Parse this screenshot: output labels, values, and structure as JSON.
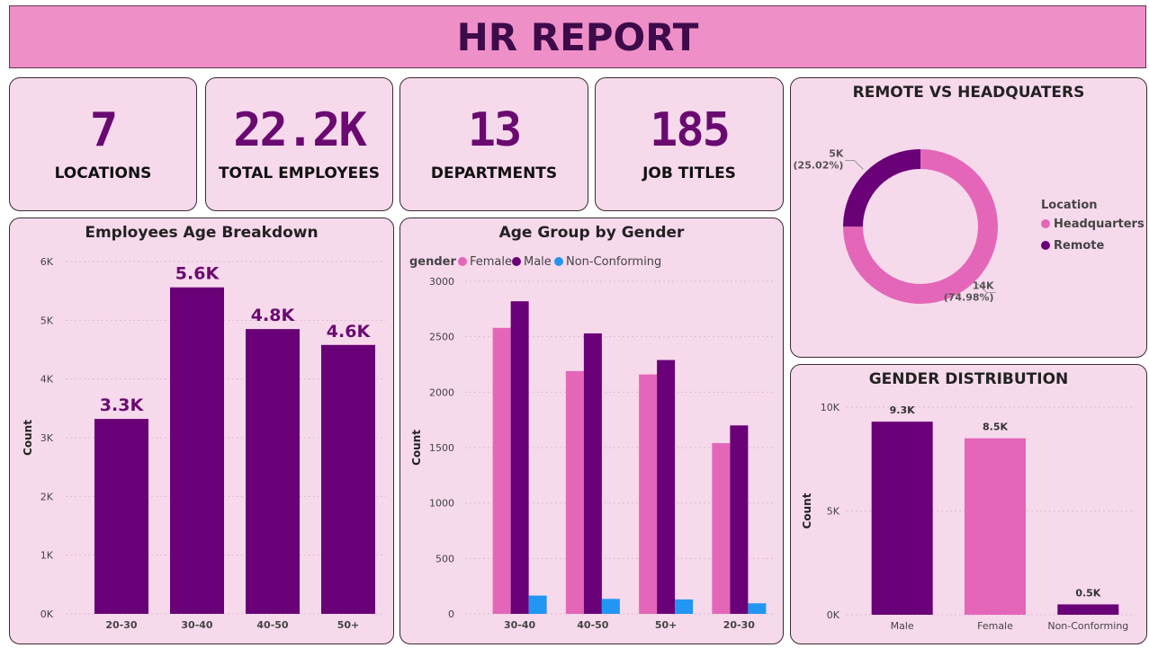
{
  "header": {
    "title": "HR REPORT"
  },
  "kpis": [
    {
      "value": "7",
      "label": "LOCATIONS"
    },
    {
      "value": "22.2K",
      "label": "TOTAL EMPLOYEES"
    },
    {
      "value": "13",
      "label": "DEPARTMENTS"
    },
    {
      "value": "185",
      "label": "JOB TITLES"
    }
  ],
  "colors": {
    "dark_purple": "#6a0077",
    "pink": "#e466b8",
    "blue": "#2196f3",
    "card_bg": "#f7d9ec",
    "header_bg": "#ee8fc8"
  },
  "chart_data": [
    {
      "type": "bar",
      "title": "Employees Age Breakdown",
      "xlabel": "",
      "ylabel": "Count",
      "categories": [
        "20-30",
        "30-40",
        "40-50",
        "50+"
      ],
      "values": [
        3320,
        5560,
        4850,
        4580
      ],
      "data_labels": [
        "3.3K",
        "5.6K",
        "4.8K",
        "4.6K"
      ],
      "ylim": [
        0,
        6000
      ],
      "yticks": [
        0,
        1000,
        2000,
        3000,
        4000,
        5000,
        6000
      ],
      "ytick_labels": [
        "0K",
        "1K",
        "2K",
        "3K",
        "4K",
        "5K",
        "6K"
      ],
      "grid": true
    },
    {
      "type": "bar",
      "title": "Age Group by Gender",
      "xlabel": "",
      "ylabel": "Count",
      "legend_title": "gender",
      "legend_position": "top-left",
      "categories": [
        "30-40",
        "40-50",
        "50+",
        "20-30"
      ],
      "series": [
        {
          "name": "Female",
          "color": "#e466b8",
          "values": [
            2580,
            2190,
            2160,
            1540
          ]
        },
        {
          "name": "Male",
          "color": "#6a0077",
          "values": [
            2820,
            2530,
            2290,
            1700
          ]
        },
        {
          "name": "Non-Conforming",
          "color": "#2196f3",
          "values": [
            165,
            135,
            130,
            95
          ]
        }
      ],
      "ylim": [
        0,
        3000
      ],
      "yticks": [
        0,
        500,
        1000,
        1500,
        2000,
        2500,
        3000
      ],
      "ytick_labels": [
        "0",
        "500",
        "1000",
        "1500",
        "2000",
        "2500",
        "3000"
      ],
      "grid": true
    },
    {
      "type": "pie",
      "subtype": "donut",
      "title": "REMOTE VS HEADQUATERS",
      "legend_title": "Location",
      "legend_position": "right",
      "slices": [
        {
          "name": "Headquarters",
          "value": 74.98,
          "label": "14K",
          "percent_label": "(74.98%)",
          "color": "#e466b8"
        },
        {
          "name": "Remote",
          "value": 25.02,
          "label": "5K",
          "percent_label": "(25.02%)",
          "color": "#6a0077"
        }
      ]
    },
    {
      "type": "bar",
      "title": "GENDER DISTRIBUTION",
      "xlabel": "",
      "ylabel": "Count",
      "categories": [
        "Male",
        "Female",
        "Non-Conforming"
      ],
      "values": [
        9300,
        8500,
        500
      ],
      "data_labels": [
        "9.3K",
        "8.5K",
        "0.5K"
      ],
      "colors": [
        "#6a0077",
        "#e466b8",
        "#6a0077"
      ],
      "ylim": [
        0,
        10000
      ],
      "yticks": [
        0,
        5000,
        10000
      ],
      "ytick_labels": [
        "0K",
        "5K",
        "10K"
      ],
      "grid": true
    }
  ]
}
